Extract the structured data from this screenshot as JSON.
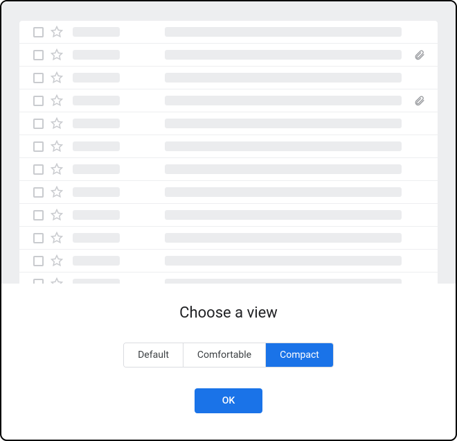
{
  "title": "Choose a view",
  "options": {
    "default": "Default",
    "comfortable": "Comfortable",
    "compact": "Compact"
  },
  "selected_option": "compact",
  "ok_button": "OK",
  "preview_rows": [
    {
      "has_attachment": false
    },
    {
      "has_attachment": true
    },
    {
      "has_attachment": false
    },
    {
      "has_attachment": true
    },
    {
      "has_attachment": false
    },
    {
      "has_attachment": false
    },
    {
      "has_attachment": false
    },
    {
      "has_attachment": false
    },
    {
      "has_attachment": false
    },
    {
      "has_attachment": false
    },
    {
      "has_attachment": false
    },
    {
      "has_attachment": false
    }
  ]
}
